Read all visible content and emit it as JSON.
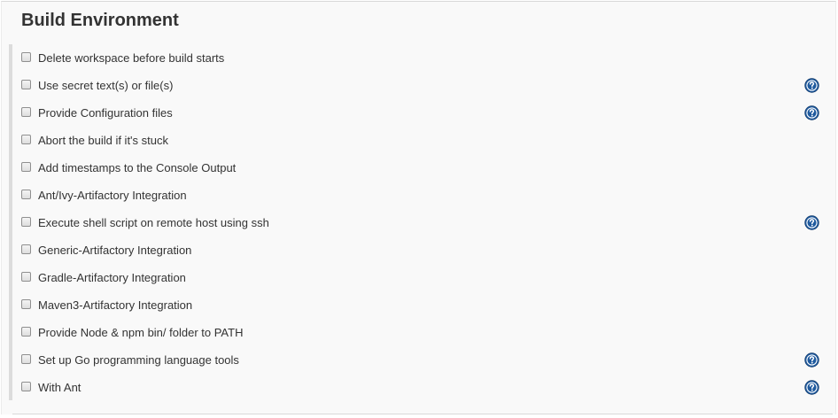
{
  "section": {
    "title": "Build Environment"
  },
  "colors": {
    "help_icon_fill": "#1f5a9e",
    "help_icon_glyph": "#ffffff",
    "panel_background": "#f9f9f9"
  },
  "options": [
    {
      "label": "Delete workspace before build starts",
      "checked": false,
      "help": false
    },
    {
      "label": "Use secret text(s) or file(s)",
      "checked": false,
      "help": true
    },
    {
      "label": "Provide Configuration files",
      "checked": false,
      "help": true
    },
    {
      "label": "Abort the build if it's stuck",
      "checked": false,
      "help": false
    },
    {
      "label": "Add timestamps to the Console Output",
      "checked": false,
      "help": false
    },
    {
      "label": "Ant/Ivy-Artifactory Integration",
      "checked": false,
      "help": false
    },
    {
      "label": "Execute shell script on remote host using ssh",
      "checked": false,
      "help": true
    },
    {
      "label": "Generic-Artifactory Integration",
      "checked": false,
      "help": false
    },
    {
      "label": "Gradle-Artifactory Integration",
      "checked": false,
      "help": false
    },
    {
      "label": "Maven3-Artifactory Integration",
      "checked": false,
      "help": false
    },
    {
      "label": "Provide Node & npm bin/ folder to PATH",
      "checked": false,
      "help": false
    },
    {
      "label": "Set up Go programming language tools",
      "checked": false,
      "help": true
    },
    {
      "label": "With Ant",
      "checked": false,
      "help": true
    }
  ],
  "icons": {
    "help": "question-circle-icon"
  }
}
